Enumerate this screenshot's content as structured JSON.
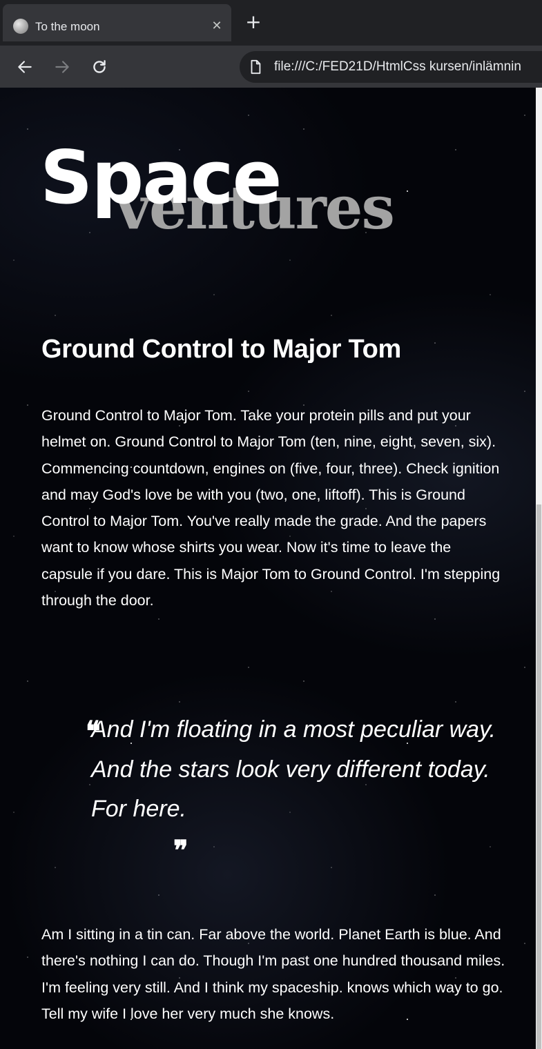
{
  "browser": {
    "tab_title": "To the moon",
    "tab_close": "✕",
    "new_tab": "+",
    "url": "file:///C:/FED21D/HtmlCss kursen/inlämnin"
  },
  "page": {
    "logo": {
      "word1": "Space",
      "word2": "ventures"
    },
    "heading": "Ground Control to Major Tom",
    "paragraph1": "Ground Control to Major Tom. Take your protein pills and put your helmet on. Ground Control to Major Tom (ten, nine, eight, seven, six). Commencing countdown, engines on (five, four, three). Check ignition and may God's love be with you (two, one, liftoff). This is Ground Control to Major Tom. You've really made the grade. And the papers want to know whose shirts you wear. Now it's time to leave the capsule if you dare. This is Major Tom to Ground Control. I'm stepping through the door.",
    "quote": {
      "open_mark": "❝",
      "line1": "And I'm floating in a most peculiar way. And the stars look very different today.",
      "line2": "For here.",
      "close_mark": "❞"
    },
    "paragraph2": "Am I sitting in a tin can. Far above the world. Planet Earth is blue. And there's nothing I can do. Though I'm past one hundred thousand miles. I'm feeling very still. And I think my spaceship. knows which way to go. Tell my wife I love her very much she knows."
  }
}
